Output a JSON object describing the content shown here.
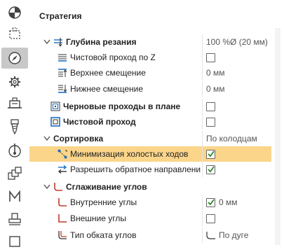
{
  "panel_title": "Стратегия",
  "rows": [
    {
      "label": "Глубина резания",
      "value": "100 %Ø (20 мм)"
    },
    {
      "label": "Чистовой проход по Z"
    },
    {
      "label": "Верхнее смещение",
      "value": "0 мм"
    },
    {
      "label": "Нижнее смещение",
      "value": "0 мм"
    },
    {
      "label": "Черновые проходы в плане"
    },
    {
      "label": "Чистовой проход"
    },
    {
      "label": "Сортировка",
      "value": "По колодцам"
    },
    {
      "label": "Минимизация холостых ходов"
    },
    {
      "label": "Разрешить обратное направление"
    },
    {
      "label": "Сглаживание углов"
    },
    {
      "label": "Внутренние углы",
      "value": "0 мм"
    },
    {
      "label": "Внешние углы"
    },
    {
      "label": "Тип обката углов",
      "value": "По дуге"
    }
  ],
  "toolbar": {
    "icons": [
      "pie-chart-icon",
      "dashed-square-icon",
      "compass-icon",
      "gear-icon",
      "tool-holder-icon",
      "drill-bit-icon",
      "spindle-icon",
      "layers-icon",
      "m-code-icon",
      "stamp-icon",
      "square-icon"
    ]
  },
  "colors": {
    "selection": "#fbd58a",
    "accent": "#1a6fc4",
    "check": "#2a8a2a"
  }
}
